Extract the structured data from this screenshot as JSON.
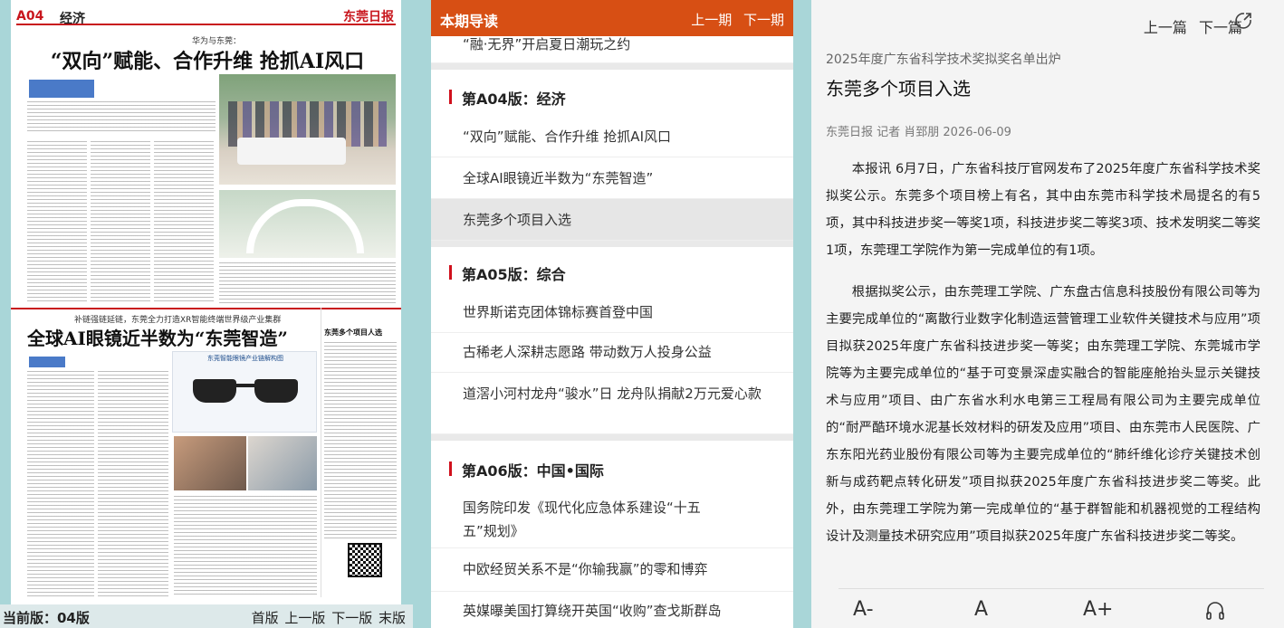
{
  "paper": {
    "page_no": "A04",
    "section": "经济",
    "logo": "东莞日报",
    "kicker1": "华为与东莞：",
    "headline1": "“双向”赋能、合作升维 抢抓AI风口",
    "kicker2": "补链强链延链，东莞全力打造XR智能终端世界级产业集群",
    "headline2": "全球AI眼镜近半数为“东莞智造”",
    "graphic_title": "东莞智能眼镜产业链解构图",
    "side_title": "东莞多个项目人选"
  },
  "footer": {
    "current_page": "当前版：04版",
    "first": "首版",
    "prev": "上一版",
    "next": "下一版",
    "last": "末版"
  },
  "guide": {
    "title": "本期导读",
    "prev": "上一期",
    "next": "下一期",
    "top_item": "“融·无界”开启夏日潮玩之约",
    "sections": [
      {
        "name": "第A04版：经济",
        "items": [
          "“双向”赋能、合作升维 抢抓AI风口",
          "全球AI眼镜近半数为“东莞智造”",
          "东莞多个项目入选"
        ]
      },
      {
        "name": "第A05版：综合",
        "items": [
          "世界斯诺克团体锦标赛首登中国",
          "古稀老人深耕志愿路 带动数万人投身公益",
          "道滘小河村龙舟“骏水”日 龙舟队捐献2万元爱心款"
        ]
      },
      {
        "name": "第A06版：中国•国际",
        "items": [
          "国务院印发《现代化应急体系建设“十五五”规划》",
          "中欧经贸关系不是“你输我赢”的零和博弈",
          "英媒曝美国打算绕开英国“收购”查戈斯群岛"
        ]
      }
    ]
  },
  "article": {
    "prev": "上一篇",
    "next": "下一篇",
    "kicker": "2025年度广东省科学技术奖拟奖名单出炉",
    "title": "东莞多个项目入选",
    "byline": "东莞日报 记者 肖郅朋 2026-06-09",
    "para1": "本报讯 6月7日，广东省科技厅官网发布了2025年度广东省科学技术奖拟奖公示。东莞多个项目榜上有名，其中由东莞市科学技术局提名的有5项，其中科技进步奖一等奖1项，科技进步奖二等奖3项、技术发明奖二等奖1项，东莞理工学院作为第一完成单位的有1项。",
    "para2": "根据拟奖公示，由东莞理工学院、广东盘古信息科技股份有限公司等为主要完成单位的“离散行业数字化制造运营管理工业软件关键技术与应用”项目拟获2025年度广东省科技进步奖一等奖；由东莞理工学院、东莞城市学院等为主要完成单位的“基于可变景深虚实融合的智能座舱抬头显示关键技术与应用”项目、由广东省水利水电第三工程局有限公司为主要完成单位的“耐严酷环境水泥基长效材料的研发及应用”项目、由东莞市人民医院、广东东阳光药业股份有限公司等为主要完成单位的“肺纤维化诊疗关键技术创新与成药靶点转化研发”项目拟获2025年度广东省科技进步奖二等奖。此外，由东莞理工学院为第一完成单位的“基于群智能和机器视觉的工程结构设计及测量技术研究应用”项目拟获2025年度广东省科技进步奖二等奖。",
    "font_smaller": "A-",
    "font_normal": "A",
    "font_larger": "A+"
  },
  "colors": {
    "accent": "#d74f14",
    "section_bar": "#d0101c",
    "paper_red": "#c8161d"
  }
}
